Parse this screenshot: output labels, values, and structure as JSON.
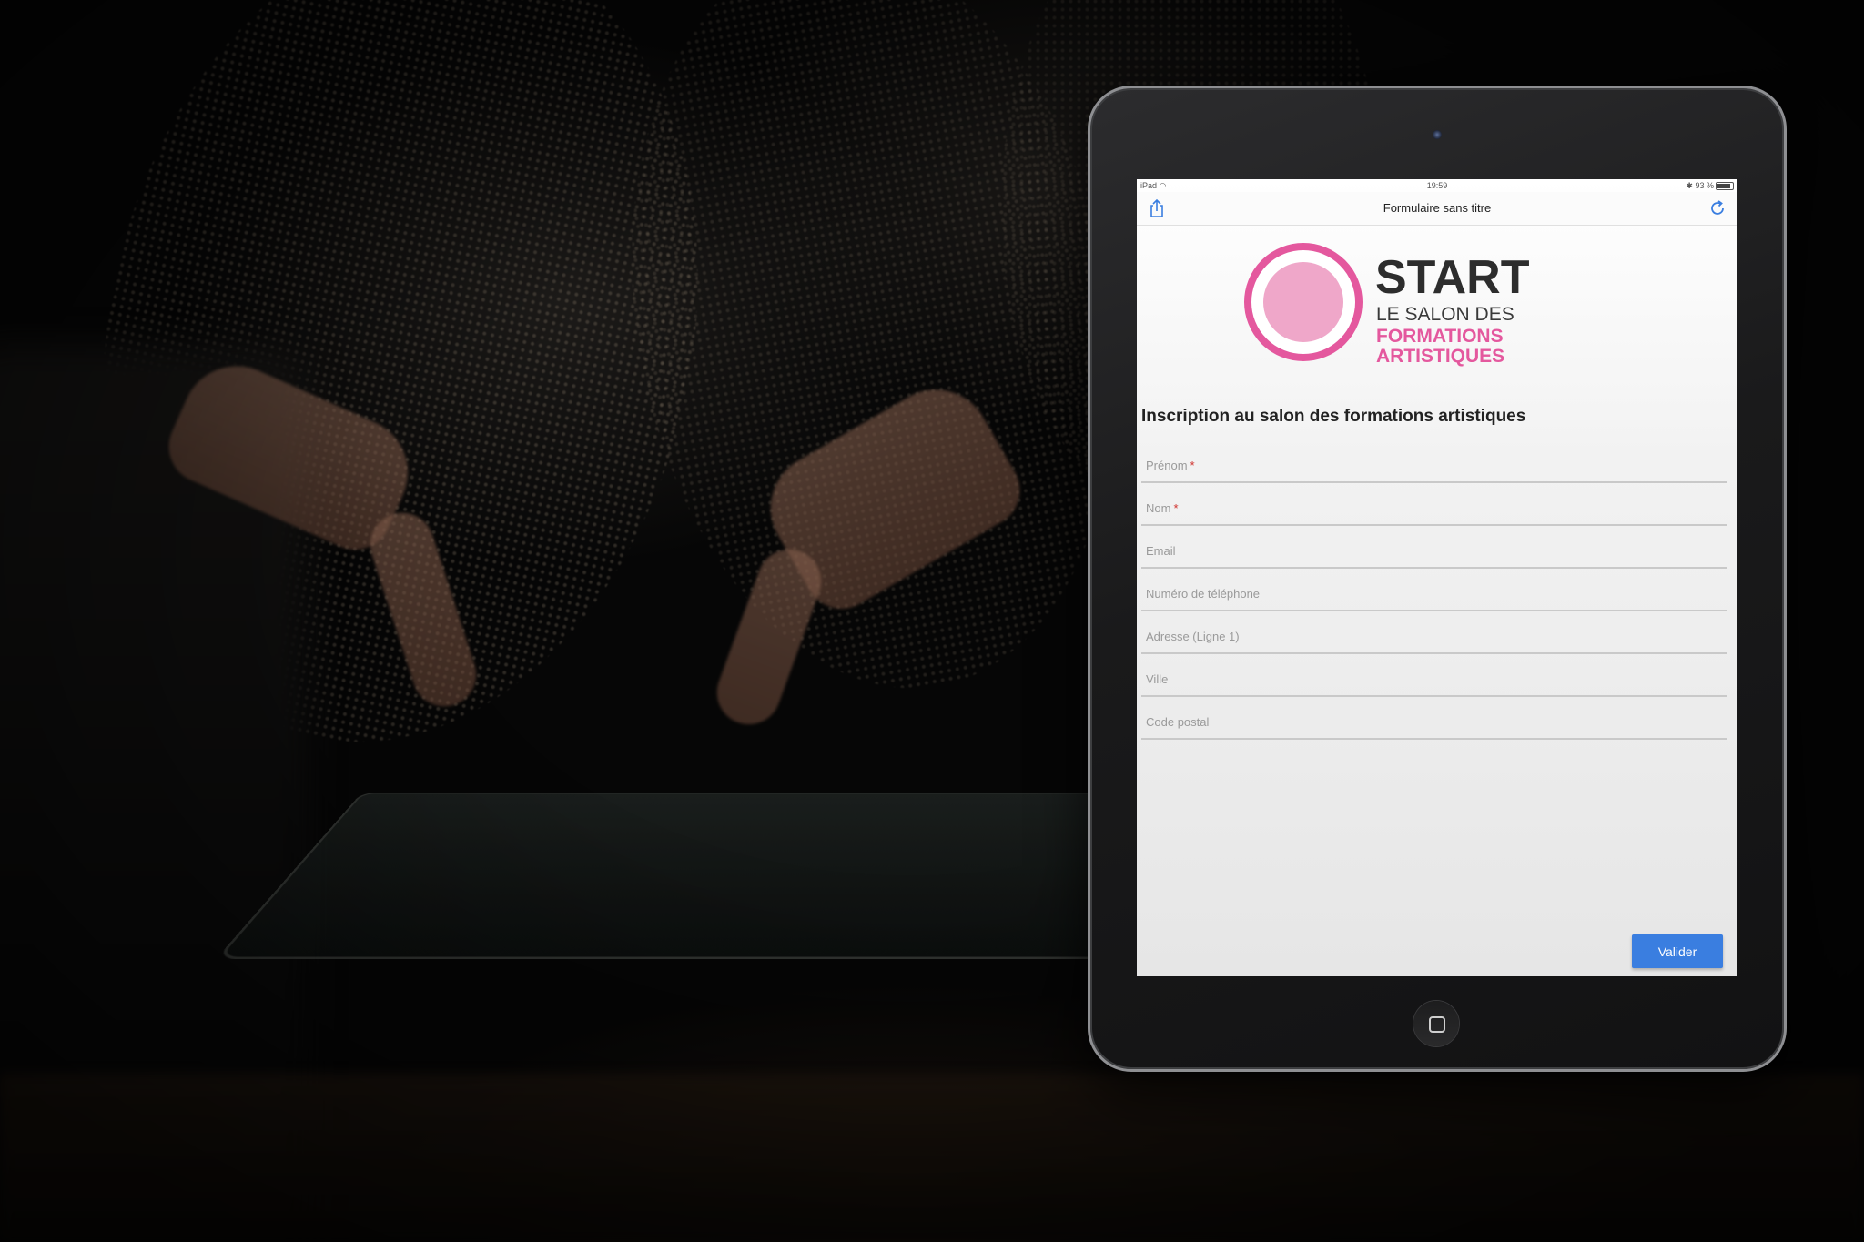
{
  "status_bar": {
    "carrier": "iPad",
    "time": "19:59",
    "battery": "93 %"
  },
  "nav": {
    "title": "Formulaire sans titre",
    "share_icon": "share-icon",
    "refresh_icon": "refresh-icon"
  },
  "logo": {
    "line1": "START",
    "line2": "LE SALON DES",
    "line3": "FORMATIONS ARTISTIQUES",
    "colors": {
      "pink": "#e4589e",
      "pink_light": "#efa7c9",
      "dark": "#2d2d2d"
    }
  },
  "form": {
    "title": "Inscription au salon des formations artistiques",
    "required_mark": "*",
    "fields": [
      {
        "label": "Prénom",
        "required": true
      },
      {
        "label": "Nom",
        "required": true
      },
      {
        "label": "Email",
        "required": false
      },
      {
        "label": "Numéro de téléphone",
        "required": false
      },
      {
        "label": "Adresse (Ligne 1)",
        "required": false
      },
      {
        "label": "Ville",
        "required": false
      },
      {
        "label": "Code postal",
        "required": false
      }
    ],
    "submit_label": "Valider",
    "submit_color": "#3a7ee0",
    "required_color": "#d0312d"
  }
}
